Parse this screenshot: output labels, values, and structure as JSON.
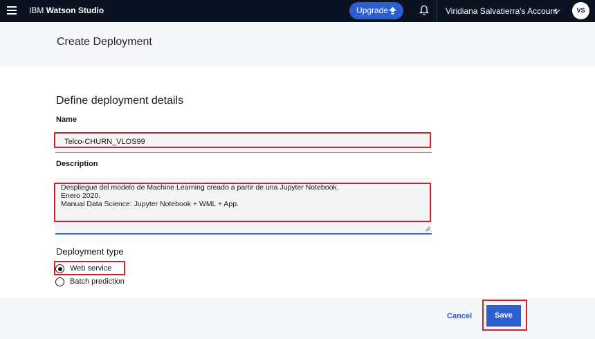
{
  "header": {
    "brand_prefix": "IBM ",
    "brand_name": "Watson Studio",
    "upgrade_label": "Upgrade",
    "account_label": "Viridiana Salvatierra's Account",
    "avatar_initials": "VS"
  },
  "page": {
    "title": "Create Deployment"
  },
  "form": {
    "section_title": "Define deployment details",
    "name_label": "Name",
    "name_value": "Telco-CHURN_VLOS99",
    "description_label": "Description",
    "description_value": "Despliegue del modelo de Machine Learning creado a partir de una Jupyter Notebook.\nEnero 2020.\nManual Data Science: Jupyter Notebook + WML + App.",
    "deployment_type_label": "Deployment type",
    "options": [
      {
        "label": "Web service",
        "selected": true
      },
      {
        "label": "Batch prediction",
        "selected": false
      }
    ]
  },
  "footer": {
    "cancel_label": "Cancel",
    "save_label": "Save"
  },
  "colors": {
    "topbar": "#0b1222",
    "primary": "#2e5fce",
    "annotation": "#d0202e"
  },
  "icons": [
    "menu-icon",
    "upgrade-arrow-icon",
    "bell-icon",
    "chevron-down-icon",
    "radio-checked-icon",
    "radio-unchecked-icon",
    "resize-grip-icon"
  ]
}
